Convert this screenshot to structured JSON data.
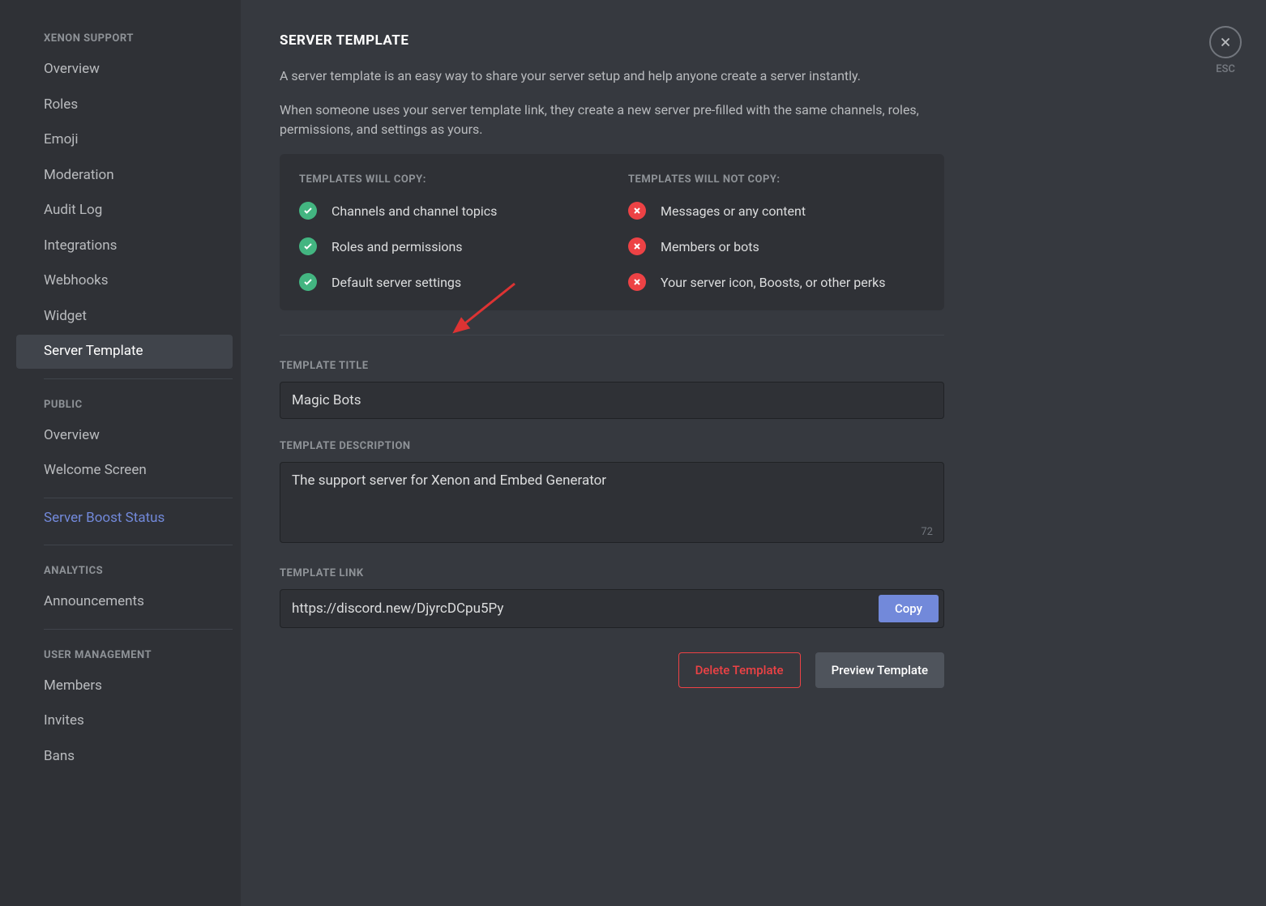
{
  "sidebar": {
    "sections": [
      {
        "header": "XENON SUPPORT",
        "items": [
          {
            "label": "Overview",
            "name": "sidebar-item-overview"
          },
          {
            "label": "Roles",
            "name": "sidebar-item-roles"
          },
          {
            "label": "Emoji",
            "name": "sidebar-item-emoji"
          },
          {
            "label": "Moderation",
            "name": "sidebar-item-moderation"
          },
          {
            "label": "Audit Log",
            "name": "sidebar-item-audit-log"
          },
          {
            "label": "Integrations",
            "name": "sidebar-item-integrations"
          },
          {
            "label": "Webhooks",
            "name": "sidebar-item-webhooks"
          },
          {
            "label": "Widget",
            "name": "sidebar-item-widget"
          },
          {
            "label": "Server Template",
            "name": "sidebar-item-server-template",
            "active": true
          }
        ]
      },
      {
        "header": "PUBLIC",
        "items": [
          {
            "label": "Overview",
            "name": "sidebar-item-public-overview"
          },
          {
            "label": "Welcome Screen",
            "name": "sidebar-item-welcome-screen"
          }
        ]
      },
      {
        "boost": {
          "label": "Server Boost Status",
          "name": "sidebar-item-boost-status"
        }
      },
      {
        "header": "ANALYTICS",
        "items": [
          {
            "label": "Announcements",
            "name": "sidebar-item-announcements"
          }
        ]
      },
      {
        "header": "USER MANAGEMENT",
        "items": [
          {
            "label": "Members",
            "name": "sidebar-item-members"
          },
          {
            "label": "Invites",
            "name": "sidebar-item-invites"
          },
          {
            "label": "Bans",
            "name": "sidebar-item-bans"
          }
        ]
      }
    ]
  },
  "close": {
    "esc": "ESC"
  },
  "page": {
    "title": "SERVER TEMPLATE",
    "desc1": "A server template is an easy way to share your server setup and help anyone create a server instantly.",
    "desc2": "When someone uses your server template link, they create a new server pre-filled with the same channels, roles, permissions, and settings as yours."
  },
  "info": {
    "copy_header": "TEMPLATES WILL COPY:",
    "copy_items": [
      "Channels and channel topics",
      "Roles and permissions",
      "Default server settings"
    ],
    "nocopy_header": "TEMPLATES WILL NOT COPY:",
    "nocopy_items": [
      "Messages or any content",
      "Members or bots",
      "Your server icon, Boosts, or other perks"
    ]
  },
  "fields": {
    "title_label": "TEMPLATE TITLE",
    "title_value": "Magic Bots",
    "desc_label": "TEMPLATE DESCRIPTION",
    "desc_value": "The support server for Xenon and Embed Generator",
    "desc_count": "72",
    "link_label": "TEMPLATE LINK",
    "link_value": "https://discord.new/DjyrcDCpu5Py"
  },
  "buttons": {
    "copy": "Copy",
    "delete": "Delete Template",
    "preview": "Preview Template"
  }
}
